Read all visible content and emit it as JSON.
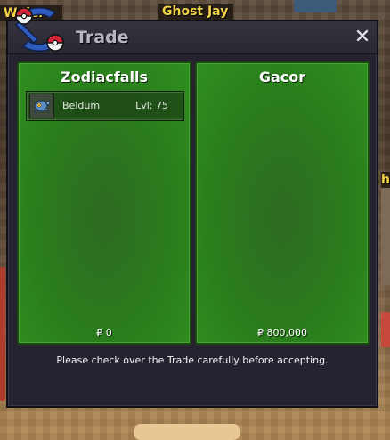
{
  "window": {
    "title": "Trade",
    "close_glyph": "✕"
  },
  "background_labels": {
    "top_left_partial": "W   ller",
    "top_center_partial": "Ghost Jay",
    "right_edge_partial": "h"
  },
  "trade": {
    "left_party": {
      "name": "Zodiacfalls",
      "items": [
        {
          "icon": "beldum-icon",
          "name": "Beldum",
          "level": "Lvl: 75"
        }
      ],
      "money": "₽ 0"
    },
    "right_party": {
      "name": "Gacor",
      "items": [],
      "money": "₽ 800,000"
    },
    "notice": "Please check over the Trade carefully before accepting."
  },
  "colors": {
    "panel_green": "#2a7c1c",
    "window_bg": "#262330",
    "title_text": "#b9b6c2",
    "accent_red": "#d4283a",
    "accent_blue": "#2f5bbd"
  }
}
